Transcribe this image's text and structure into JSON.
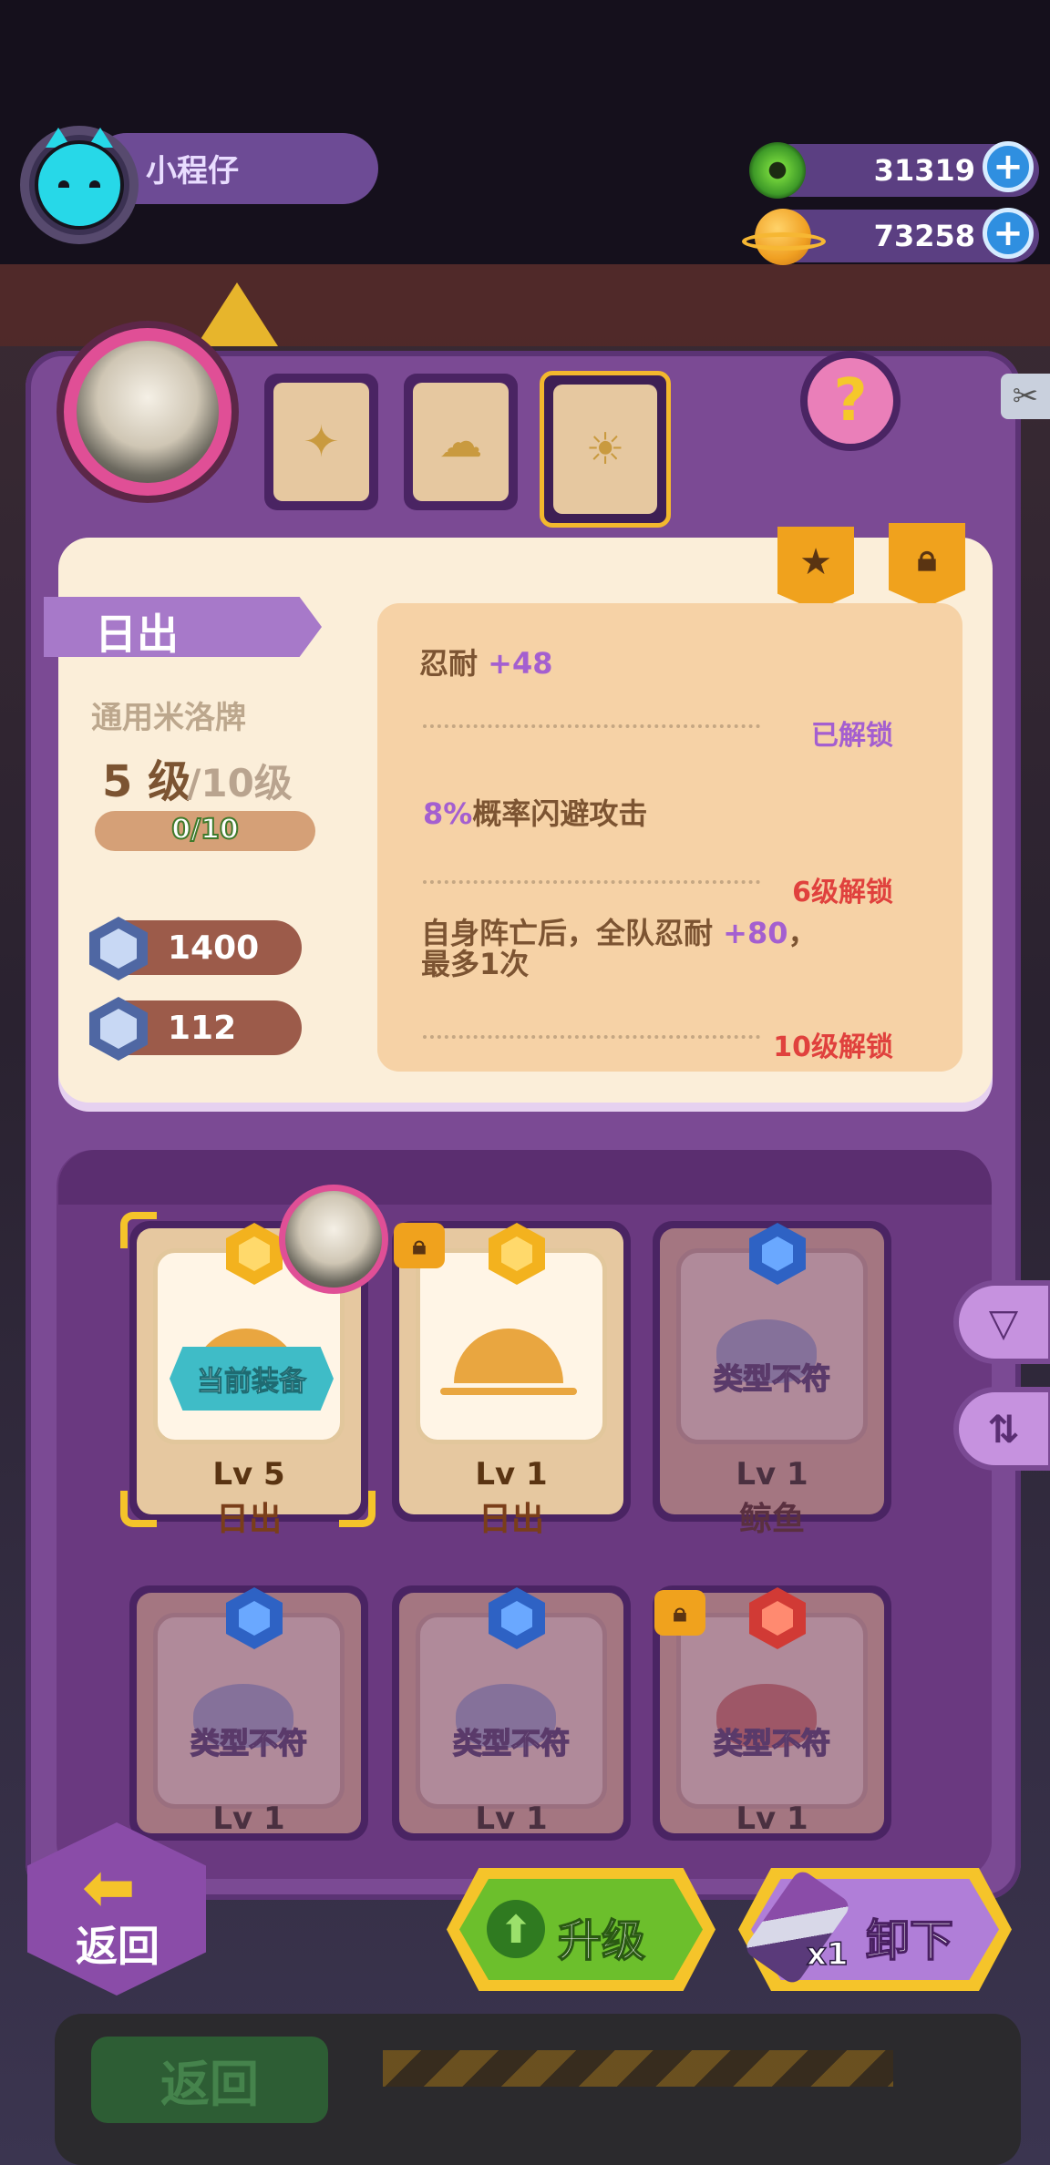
{
  "player": {
    "name": "小程仔"
  },
  "currencies": [
    {
      "name": "donut-currency",
      "value": "31319"
    },
    {
      "name": "coin-currency",
      "value": "73258"
    }
  ],
  "help": {
    "label": "?"
  },
  "card": {
    "name": "日出",
    "type": "通用米洛牌",
    "level_current": "5 级",
    "level_max": "/10级",
    "exp": "0/10",
    "stats": [
      {
        "icon": "heart-hex-icon",
        "value": "1400"
      },
      {
        "icon": "shield-hex-icon",
        "value": "112"
      }
    ],
    "traits": [
      {
        "pre": "忍耐 ",
        "hl": "+48",
        "post": "",
        "status": "已解锁",
        "unlocked": true
      },
      {
        "pre": "",
        "hl": "8%",
        "post": "概率闪避攻击",
        "status": "6级解锁",
        "unlocked": false
      },
      {
        "pre": "自身阵亡后，全队忍耐 ",
        "hl": "+80",
        "post": "，\n最多1次",
        "status": "10级解锁",
        "unlocked": false
      }
    ]
  },
  "grid": {
    "equipped_label": "当前装备",
    "mismatch_label": "类型不符",
    "lv_prefix": "Lv",
    "cards": [
      {
        "name": "日出",
        "lv": "5",
        "gem": "gold",
        "art": "sun",
        "equipped": true,
        "dim": false,
        "locked": false
      },
      {
        "name": "日出",
        "lv": "1",
        "gem": "gold",
        "art": "sun",
        "equipped": false,
        "dim": false,
        "locked": true
      },
      {
        "name": "鲸鱼",
        "lv": "1",
        "gem": "blue",
        "art": "whale",
        "equipped": false,
        "dim": true,
        "locked": false
      },
      {
        "name": "",
        "lv": "1",
        "gem": "blue",
        "art": "whale",
        "equipped": false,
        "dim": true,
        "locked": false
      },
      {
        "name": "",
        "lv": "1",
        "gem": "blue",
        "art": "whale",
        "equipped": false,
        "dim": true,
        "locked": false
      },
      {
        "name": "",
        "lv": "1",
        "gem": "red",
        "art": "pot",
        "equipped": false,
        "dim": true,
        "locked": true
      }
    ]
  },
  "buttons": {
    "back": "返回",
    "upgrade": "升级",
    "unequip": "卸下",
    "unequip_count": "x1",
    "background_back": "返回"
  }
}
